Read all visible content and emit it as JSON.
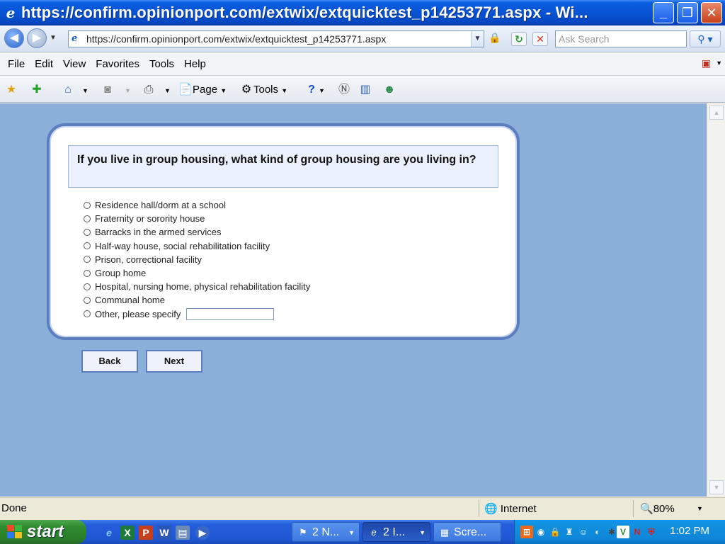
{
  "window": {
    "title": "https://confirm.opinionport.com/extwix/extquicktest_p14253771.aspx - Wi...",
    "minimize_glyph": "_",
    "maximize_glyph": "❐",
    "close_glyph": "✕"
  },
  "address_bar": {
    "url": "https://confirm.opinionport.com/extwix/extquicktest_p14253771.aspx",
    "search_placeholder": "Ask Search"
  },
  "menu": {
    "items": [
      "File",
      "Edit",
      "View",
      "Favorites",
      "Tools",
      "Help"
    ]
  },
  "command_bar": {
    "page_label": "Page",
    "tools_label": "Tools"
  },
  "survey": {
    "question": "If you live in group housing, what kind of group housing are you living in?",
    "options": [
      "Residence hall/dorm at a school",
      "Fraternity or sorority house",
      "Barracks in the armed services",
      "Half-way house, social rehabilitation facility",
      "Prison, correctional facility",
      "Group home",
      "Hospital, nursing home, physical rehabilitation facility",
      "Communal home",
      "Other, please specify"
    ],
    "other_value": "",
    "back_label": "Back",
    "next_label": "Next"
  },
  "status_bar": {
    "status": "Done",
    "zone": "Internet",
    "zoom": "80%"
  },
  "taskbar": {
    "start_label": "start",
    "tasks": [
      {
        "label": "2 N..."
      },
      {
        "label": "2 I..."
      },
      {
        "label": "Scre..."
      }
    ],
    "clock": "1:02 PM"
  },
  "colors": {
    "page_background": "#8aafd8",
    "card_border": "#5a7ec0",
    "question_background": "#eaf0fc",
    "titlebar": "#0854d4",
    "taskbar": "#245edc",
    "start_button": "#2f8a2f"
  }
}
